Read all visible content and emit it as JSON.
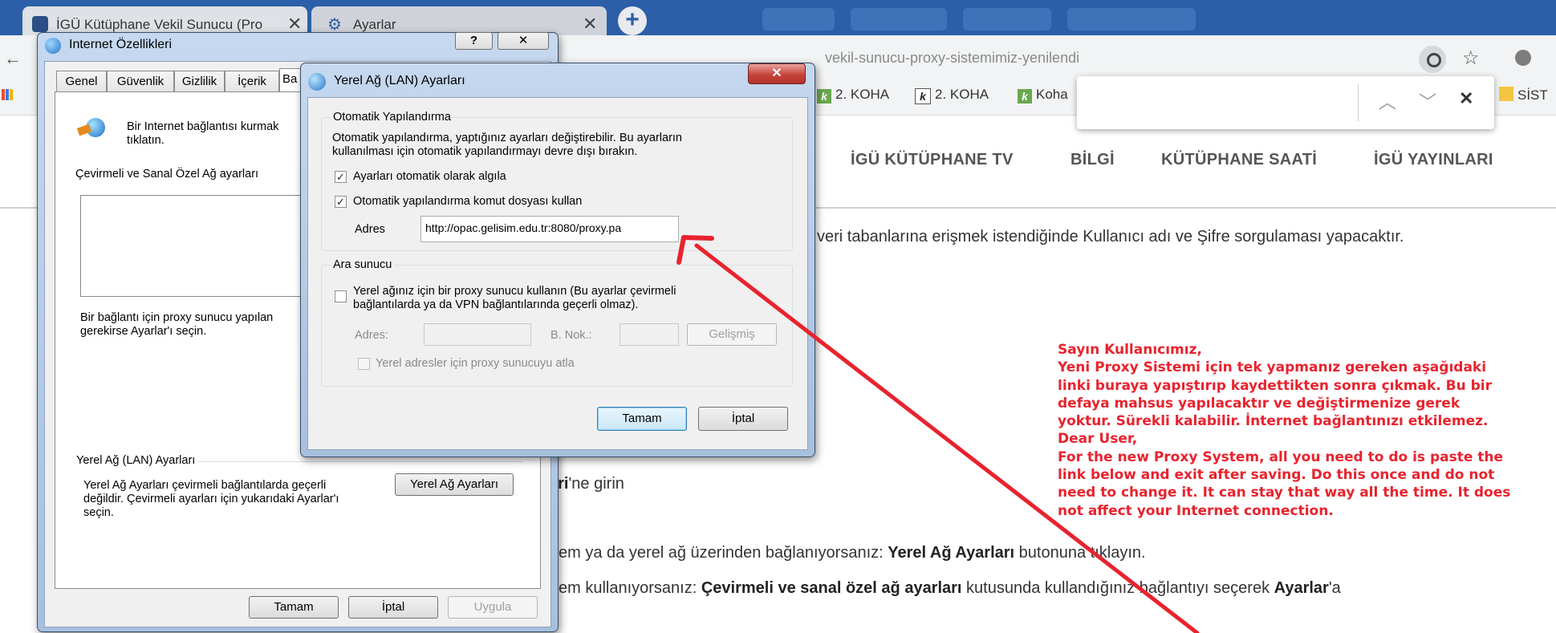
{
  "browser": {
    "tabs": [
      {
        "title": "İGÜ Kütüphane Vekil Sunucu (Pro",
        "close": "✕"
      },
      {
        "title": "Ayarlar",
        "close": "✕"
      }
    ],
    "new_tab_symbol": "+",
    "url_visible": "vekil-sunucu-proxy-sistemimiz-yenilendi",
    "bookmarks": [
      "2. KOHA",
      "2. KOHA",
      "Koha",
      "SİST"
    ],
    "find_bar": {
      "up": "︿",
      "down": "﹀",
      "close": "✕"
    }
  },
  "page": {
    "nav": [
      "İGÜ KÜTÜPHANE TV",
      "BİLGİ",
      "KÜTÜPHANE SAATİ",
      "İGÜ YAYINLARI"
    ],
    "line1": "veri tabanlarına erişmek istendiğinde Kullanıcı adı ve Şifre sorgulaması yapacaktır.",
    "line2_bold": "eri",
    "line2_rest": "'ne girin",
    "line3_pre": "em ya da yerel ağ üzerinden bağlanıyorsanız: ",
    "line3_bold": "Yerel Ağ Ayarları",
    "line3_post": " butonuna tıklayın.",
    "line4_pre": "em kullanıyorsanız: ",
    "line4_bold": "Çevirmeli ve sanal özel ağ ayarları",
    "line4_mid": " kutusunda kullandığınız bağlantıyı seçerek ",
    "line4_bold2": "Ayarlar",
    "line4_post": "'a",
    "notice": [
      "Sayın Kullanıcımız,",
      "Yeni Proxy Sistemi için tek yapmanız gereken aşağıdaki",
      "linki buraya yapıştırıp kaydettikten sonra çıkmak. Bu bir",
      "defaya mahsus yapılacaktır ve değiştirmenize gerek",
      "yoktur. Sürekli kalabilir. İnternet bağlantınızı etkilemez.",
      "Dear User,",
      "For the new Proxy System, all you need to do is paste the",
      "link below and exit after saving. Do this once and do not",
      "need to change it. It can stay that way all the time. It does",
      "not affect your Internet connection."
    ],
    "notice_color": "#e8232e"
  },
  "internet_options": {
    "title": "Internet Özellikleri",
    "help_btn": "?",
    "close_btn": "✕",
    "tabs": [
      "Genel",
      "Güvenlik",
      "Gizlilik",
      "İçerik",
      "Ba"
    ],
    "setup_text1": "Bir Internet bağlantısı kurmak",
    "setup_text2": "tıklatın.",
    "dialup_label": "Çevirmeli ve Sanal Özel Ağ ayarları",
    "proxy_hint1": "Bir bağlantı için proxy sunucu yapılan",
    "proxy_hint2": "gerekirse Ayarlar'ı seçin.",
    "lan_group": "Yerel Ağ (LAN) Ayarları",
    "lan_text1": "Yerel Ağ Ayarları çevirmeli bağlantılarda geçerli",
    "lan_text2": "değildir. Çevirmeli ayarları için yukarıdaki Ayarlar'ı",
    "lan_text3": "seçin.",
    "lan_button": "Yerel Ağ Ayarları",
    "ok": "Tamam",
    "cancel": "İptal",
    "apply": "Uygula"
  },
  "lan_dialog": {
    "title": "Yerel Ağ (LAN) Ayarları",
    "close_btn": "✕",
    "auto_group": "Otomatik Yapılandırma",
    "auto_desc1": "Otomatik yapılandırma, yaptığınız ayarları değiştirebilir. Bu ayarların",
    "auto_desc2": "kullanılması için otomatik yapılandırmayı devre dışı bırakın.",
    "auto_detect": "Ayarları otomatik olarak algıla",
    "auto_detect_checked": true,
    "use_script": "Otomatik yapılandırma komut dosyası kullan",
    "use_script_checked": true,
    "address_label": "Adres",
    "address_value": "http://opac.gelisim.edu.tr:8080/proxy.pa",
    "proxy_group": "Ara sunucu",
    "use_proxy1": "Yerel ağınız için bir proxy sunucu kullanın (Bu ayarlar çevirmeli",
    "use_proxy2": "bağlantılarda ya da VPN bağlantılarında geçerli olmaz).",
    "use_proxy_checked": false,
    "proxy_address_label": "Adres:",
    "port_label": "B. Nok.:",
    "advanced": "Gelişmiş",
    "bypass_local": "Yerel adresler için proxy sunucuyu atla",
    "ok": "Tamam",
    "cancel": "İptal"
  },
  "colors": {
    "browser_frame": "#2c5fa8",
    "arrow": "#e8232e",
    "window_title_bar": "#b9cfeb",
    "close_button_red": "#c7443b"
  }
}
